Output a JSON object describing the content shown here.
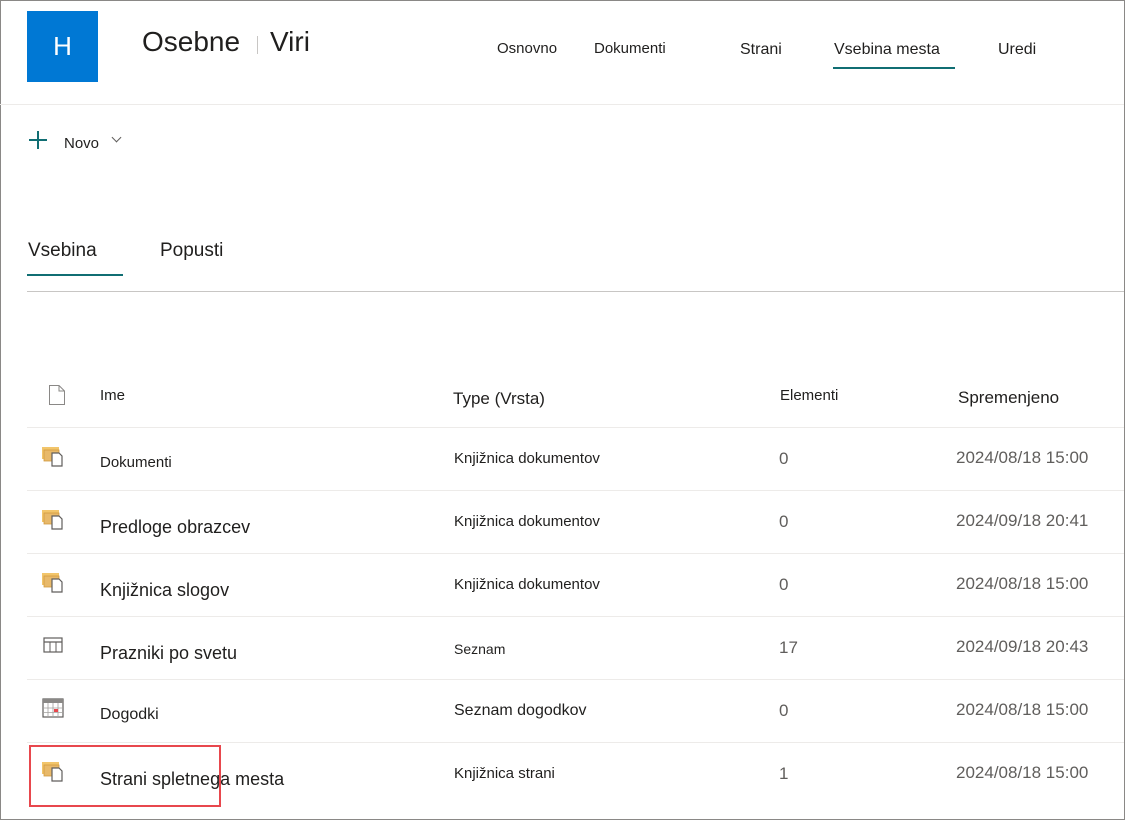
{
  "site": {
    "logo_letter": "H",
    "title_part1": "Osebne",
    "title_part2": "Viri"
  },
  "topnav": {
    "items": [
      "Osnovno",
      "Dokumenti",
      "Strani",
      "Vsebina mesta",
      "Uredi"
    ],
    "active": "Vsebina mesta"
  },
  "command_bar": {
    "new_label": "Novo"
  },
  "tabs": {
    "items": [
      "Vsebina",
      "Popusti"
    ],
    "active": "Vsebina"
  },
  "table": {
    "headers": {
      "name": "Ime",
      "type": "Type (Vrsta)",
      "items": "Elementi",
      "modified": "Spremenjeno"
    },
    "rows": [
      {
        "icon": "library-icon",
        "name": "Dokumenti",
        "type": "Knjižnica dokumentov",
        "items": "0",
        "modified": "2024/08/18 15:00"
      },
      {
        "icon": "library-icon",
        "name": "Predloge obrazcev",
        "type": "Knjižnica dokumentov",
        "items": "0",
        "modified": "2024/09/18 20:41"
      },
      {
        "icon": "library-icon",
        "name": "Knjižnica slogov",
        "type": "Knjižnica dokumentov",
        "items": "0",
        "modified": "2024/08/18 15:00"
      },
      {
        "icon": "list-icon",
        "name": "Prazniki po svetu",
        "type": "Seznam",
        "items": "17",
        "modified": "2024/09/18 20:43"
      },
      {
        "icon": "calendar-icon",
        "name": "Dogodki",
        "type": "Seznam dogodkov",
        "items": "0",
        "modified": "2024/08/18 15:00"
      },
      {
        "icon": "library-icon",
        "name": "Strani spletnega mesta",
        "type": "Knjižnica strani",
        "items": "1",
        "modified": "2024/08/18 15:00"
      }
    ],
    "highlighted_row": "Strani spletnega mesta"
  },
  "colors": {
    "accent": "#106e73",
    "logo_bg": "#0078d4",
    "highlight_border": "#e8474d",
    "library_icon": "#e8b96a"
  }
}
